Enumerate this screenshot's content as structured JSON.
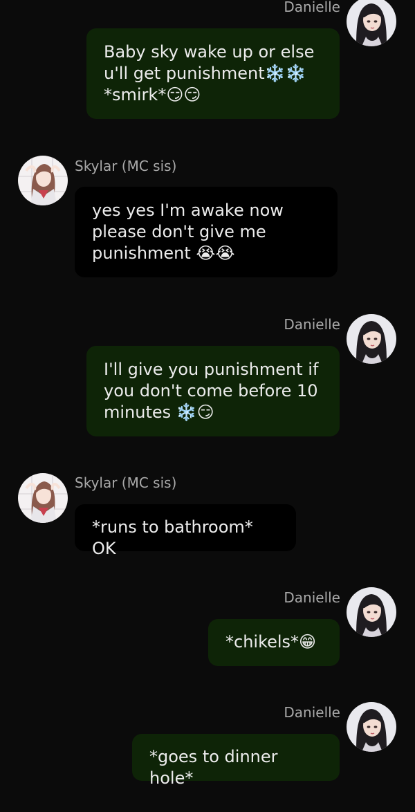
{
  "colors": {
    "background": "#0b0b0b",
    "my_bubble": "#0e2407",
    "other_bubble": "#000000",
    "name_text": "#a9a9a9",
    "message_text": "#ececec"
  },
  "messages": [
    {
      "sender": "Danielle",
      "side": "right",
      "avatar_icon": "danielle-avatar-icon",
      "text": "Baby sky wake up or else\nu'll get punishment❄️❄️\n*smirk*😏😏"
    },
    {
      "sender": "Skylar (MC sis)",
      "side": "left",
      "avatar_icon": "skylar-avatar-icon",
      "text": "yes yes I'm awake now\nplease don't give me\npunishment 😭😭"
    },
    {
      "sender": "Danielle",
      "side": "right",
      "avatar_icon": "danielle-avatar-icon",
      "text": "I'll give you punishment if\nyou don't come before 10\nminutes ❄️😏"
    },
    {
      "sender": "Skylar (MC sis)",
      "side": "left",
      "avatar_icon": "skylar-avatar-icon",
      "text": "*runs to bathroom* OK"
    },
    {
      "sender": "Danielle",
      "side": "right",
      "avatar_icon": "danielle-avatar-icon",
      "text": "*chikels*😁"
    },
    {
      "sender": "Danielle",
      "side": "right",
      "avatar_icon": "danielle-avatar-icon",
      "text": "*goes to dinner hole*"
    }
  ]
}
